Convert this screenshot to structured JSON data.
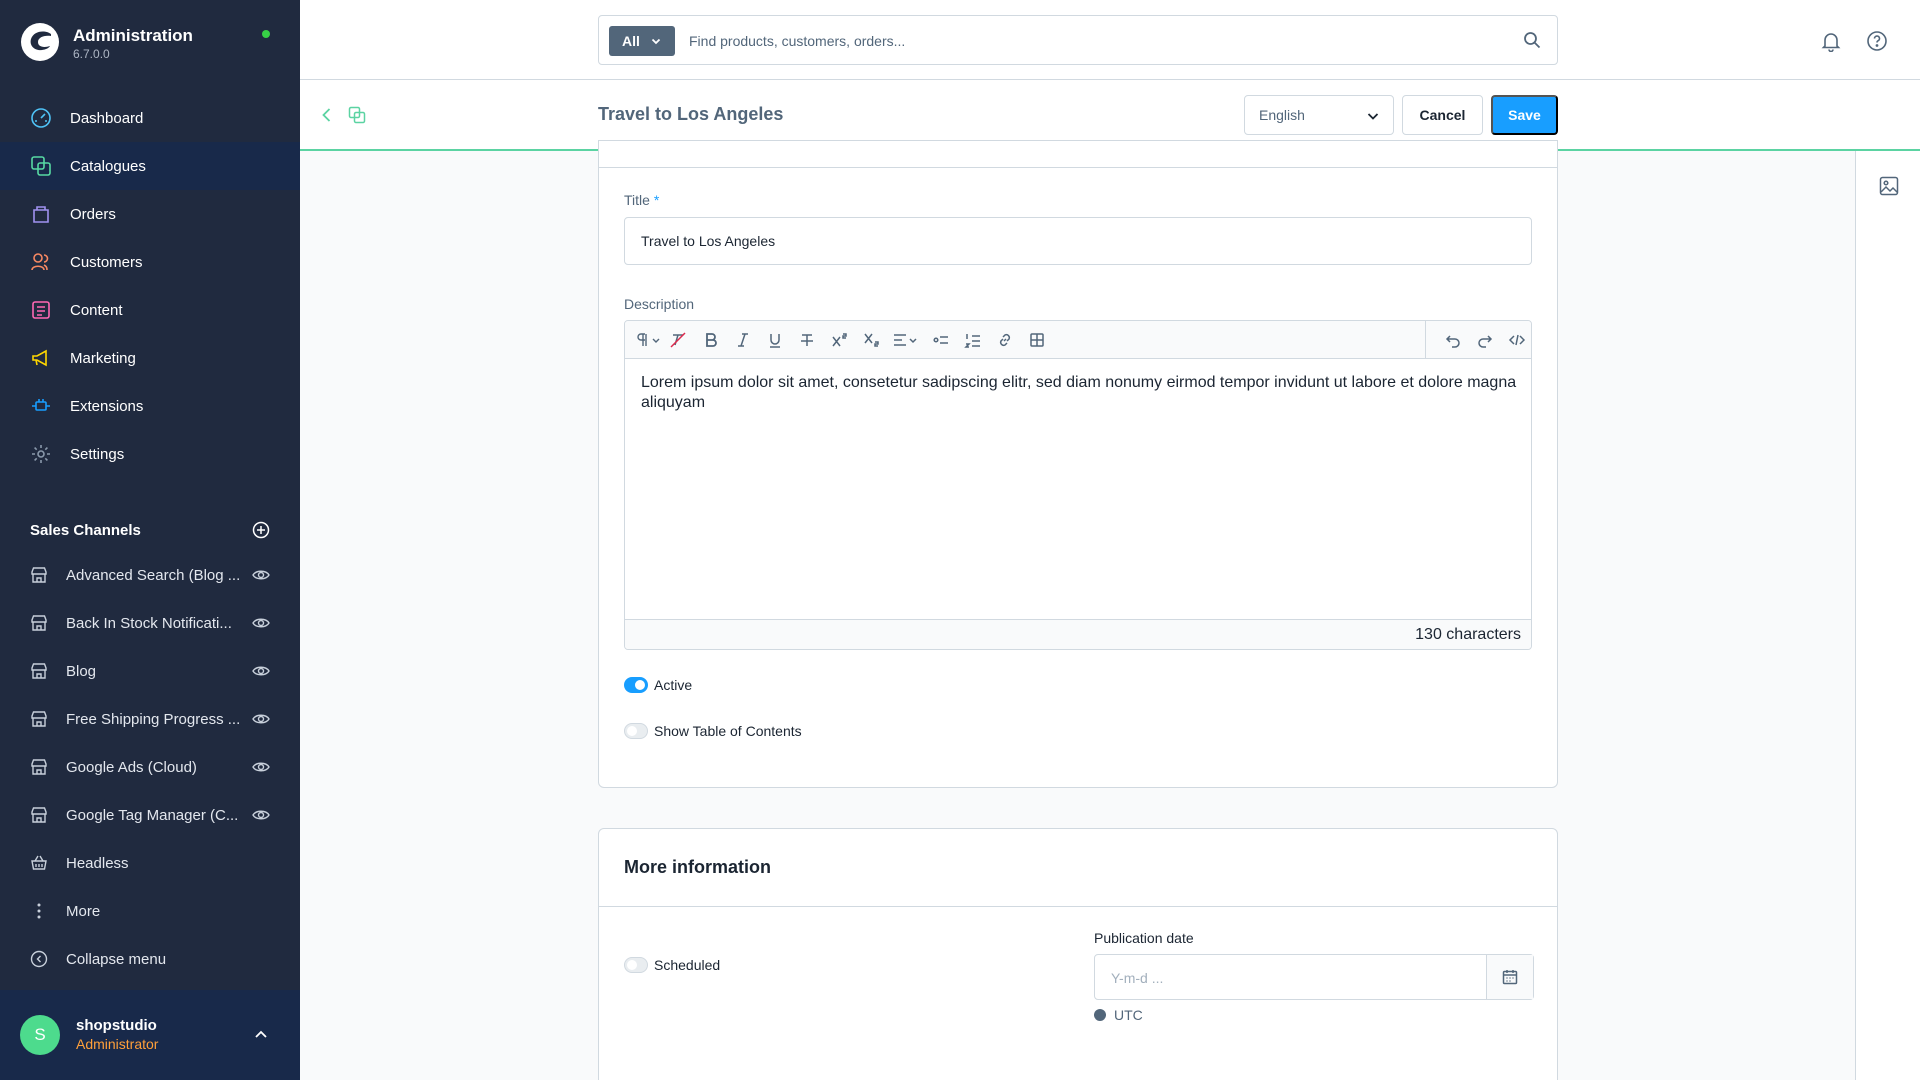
{
  "app": {
    "title": "Administration",
    "version": "6.7.0.0",
    "status_color": "#37d046"
  },
  "nav": {
    "items": [
      {
        "label": "Dashboard",
        "icon": "dashboard-gauge-icon"
      },
      {
        "label": "Catalogues",
        "icon": "catalogue-icon",
        "active": true
      },
      {
        "label": "Orders",
        "icon": "orders-bag-icon"
      },
      {
        "label": "Customers",
        "icon": "customers-icon"
      },
      {
        "label": "Content",
        "icon": "content-icon"
      },
      {
        "label": "Marketing",
        "icon": "megaphone-icon"
      },
      {
        "label": "Extensions",
        "icon": "plug-icon"
      },
      {
        "label": "Settings",
        "icon": "gear-icon"
      }
    ]
  },
  "sales_channels": {
    "title": "Sales Channels",
    "items": [
      {
        "label": "Advanced Search (Blog ..."
      },
      {
        "label": "Back In Stock Notificati..."
      },
      {
        "label": "Blog"
      },
      {
        "label": "Free Shipping Progress ..."
      },
      {
        "label": "Google Ads (Cloud)"
      },
      {
        "label": "Google Tag Manager (C..."
      },
      {
        "label": "Headless"
      }
    ],
    "more_label": "More",
    "collapse_label": "Collapse menu"
  },
  "user": {
    "initial": "S",
    "name": "shopstudio",
    "role": "Administrator"
  },
  "search": {
    "type_label": "All",
    "placeholder": "Find products, customers, orders..."
  },
  "smartbar": {
    "title": "Travel to Los Angeles",
    "language": "English",
    "cancel_label": "Cancel",
    "save_label": "Save"
  },
  "form": {
    "title_label": "Title",
    "required_mark": "*",
    "title_value": "Travel to Los Angeles",
    "description_label": "Description",
    "description_text": "Lorem ipsum dolor sit amet, consetetur sadipscing elitr, sed diam nonumy eirmod tempor invidunt ut labore et dolore magna aliquyam",
    "char_count": "130 characters",
    "active_label": "Active",
    "active": true,
    "toc_label": "Show Table of Contents",
    "toc": false
  },
  "more_info": {
    "title": "More information",
    "scheduled_label": "Scheduled",
    "scheduled": false,
    "publication_label": "Publication date",
    "date_placeholder": "Y-m-d ...",
    "timezone": "UTC"
  }
}
